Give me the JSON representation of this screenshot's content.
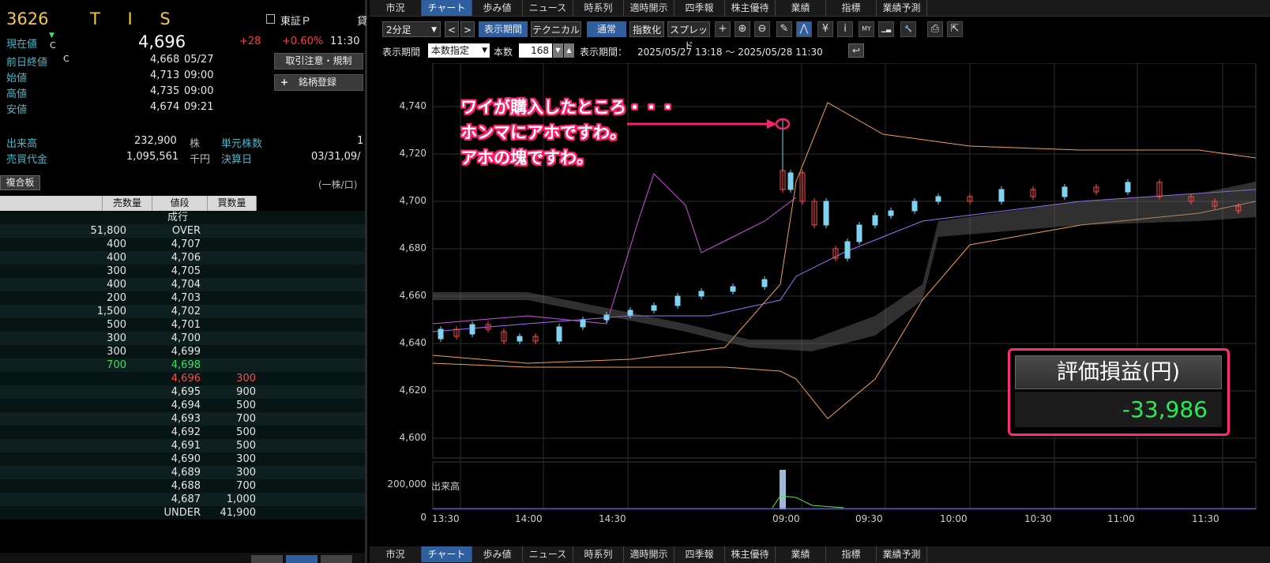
{
  "header": {
    "code": "3626",
    "name": "T I S",
    "market": "東証Ｐ",
    "market_cut": "貸"
  },
  "quote": {
    "current_label": "現在値",
    "current_flag": "C",
    "current": "4,696",
    "change": "+28",
    "change_pct": "+0.60%",
    "time": "11:30",
    "prev_close_label": "前日終値",
    "prev_close_flag": "C",
    "prev_close": "4,668",
    "prev_close_date": "05/27",
    "open_label": "始値",
    "open": "4,713",
    "open_time": "09:00",
    "high_label": "高値",
    "high": "4,735",
    "high_time": "09:00",
    "low_label": "安値",
    "low": "4,674",
    "low_time": "09:21",
    "volume_label": "出来高",
    "volume": "232,900",
    "volume_unit": "株",
    "turnover_label": "売買代金",
    "turnover": "1,095,561",
    "turnover_unit": "千円",
    "unit_shares_label": "単元株数",
    "unit_shares": "1",
    "settle_label": "決算日",
    "settle_date": "03/31,09/"
  },
  "buttons": {
    "trade_notice": "取引注意・規制",
    "add_symbol": "銘柄登録",
    "add_icon": "+"
  },
  "board": {
    "title": "複合板",
    "unit": "(一株/口)",
    "headers": [
      "売数量",
      "値段",
      "買数量"
    ],
    "rows": [
      {
        "sell": "",
        "price": "成行",
        "buy": "",
        "type": "market"
      },
      {
        "sell": "51,800",
        "price": "OVER",
        "buy": "",
        "type": "ask"
      },
      {
        "sell": "400",
        "price": "4,707",
        "buy": "",
        "type": "ask"
      },
      {
        "sell": "400",
        "price": "4,706",
        "buy": "",
        "type": "ask"
      },
      {
        "sell": "300",
        "price": "4,705",
        "buy": "",
        "type": "ask"
      },
      {
        "sell": "400",
        "price": "4,704",
        "buy": "",
        "type": "ask"
      },
      {
        "sell": "200",
        "price": "4,703",
        "buy": "",
        "type": "ask"
      },
      {
        "sell": "1,500",
        "price": "4,702",
        "buy": "",
        "type": "ask"
      },
      {
        "sell": "500",
        "price": "4,701",
        "buy": "",
        "type": "ask"
      },
      {
        "sell": "300",
        "price": "4,700",
        "buy": "",
        "type": "ask"
      },
      {
        "sell": "300",
        "price": "4,699",
        "buy": "",
        "type": "ask"
      },
      {
        "sell": "700",
        "price": "4,698",
        "buy": "",
        "type": "ask-best"
      },
      {
        "sell": "",
        "price": "4,696",
        "buy": "300",
        "type": "bid-best"
      },
      {
        "sell": "",
        "price": "4,695",
        "buy": "900",
        "type": "bid"
      },
      {
        "sell": "",
        "price": "4,694",
        "buy": "500",
        "type": "bid"
      },
      {
        "sell": "",
        "price": "4,693",
        "buy": "700",
        "type": "bid"
      },
      {
        "sell": "",
        "price": "4,692",
        "buy": "500",
        "type": "bid"
      },
      {
        "sell": "",
        "price": "4,691",
        "buy": "500",
        "type": "bid"
      },
      {
        "sell": "",
        "price": "4,690",
        "buy": "300",
        "type": "bid"
      },
      {
        "sell": "",
        "price": "4,689",
        "buy": "300",
        "type": "bid"
      },
      {
        "sell": "",
        "price": "4,688",
        "buy": "700",
        "type": "bid"
      },
      {
        "sell": "",
        "price": "4,687",
        "buy": "1,000",
        "type": "bid"
      },
      {
        "sell": "",
        "price": "UNDER",
        "buy": "41,900",
        "type": "bid"
      }
    ]
  },
  "tabs": [
    "市況",
    "チャート",
    "歩み値",
    "ニュース",
    "時系列",
    "適時開示",
    "四季報",
    "株主優待",
    "業績",
    "指標",
    "業績予測"
  ],
  "active_tab": "チャート",
  "toolbar": {
    "interval": "2分足",
    "prev": "<",
    "next": ">",
    "display_period": "表示期間",
    "technical": "テクニカル",
    "normal": "通常",
    "index": "指数化",
    "spread": "スプレッド",
    "icons": [
      "plus-icon",
      "zoom-in-icon",
      "zoom-out-icon",
      "pencil-icon",
      "draw-line-icon",
      "yen-icon",
      "info-icon",
      "my-icon",
      "volume-profile-icon",
      "wrench-icon",
      "print-icon",
      "export-icon"
    ],
    "icon_glyphs": [
      "+",
      "⊕",
      "⊖",
      "✎",
      "⋀",
      "¥",
      "i",
      "MY",
      "▁▃",
      "🔧",
      "⎙",
      "⇱"
    ]
  },
  "period_bar": {
    "label": "表示期間",
    "mode": "本数指定",
    "count_label": "本数",
    "count": "168",
    "range_label": "表示期間：",
    "range": "2025/05/27 13:18 〜 2025/05/28 11:30"
  },
  "annotation": {
    "lines": [
      "ワイが購入したところ・・・",
      "ホンマにアホですわ。",
      "アホの塊ですわ。"
    ]
  },
  "pnl": {
    "label": "評価損益(円)",
    "value": "-33,986"
  },
  "chart_data": {
    "type": "candlestick",
    "interval": "2分足",
    "price_axis": {
      "ticks": [
        "4,740",
        "4,720",
        "4,700",
        "4,680",
        "4,660",
        "4,640",
        "4,620",
        "4,600"
      ],
      "ylim": [
        4595,
        4745
      ]
    },
    "volume_axis": {
      "ticks": [
        "200,000",
        "0"
      ],
      "label": "出来高"
    },
    "x_ticks": [
      "13:30",
      "14:00",
      "14:30",
      "09:00",
      "09:30",
      "10:00",
      "10:30",
      "11:00",
      "11:30"
    ],
    "session": {
      "prev_close": 4668,
      "open": 4713,
      "high": 4735,
      "low": 4674,
      "last": 4696
    },
    "grid": true,
    "colors": {
      "up": "#7fd3f0",
      "down": "#ff4a4a",
      "bb": "#f0a050",
      "ma": "#a070ff",
      "volume": "#a0b8d8"
    }
  }
}
